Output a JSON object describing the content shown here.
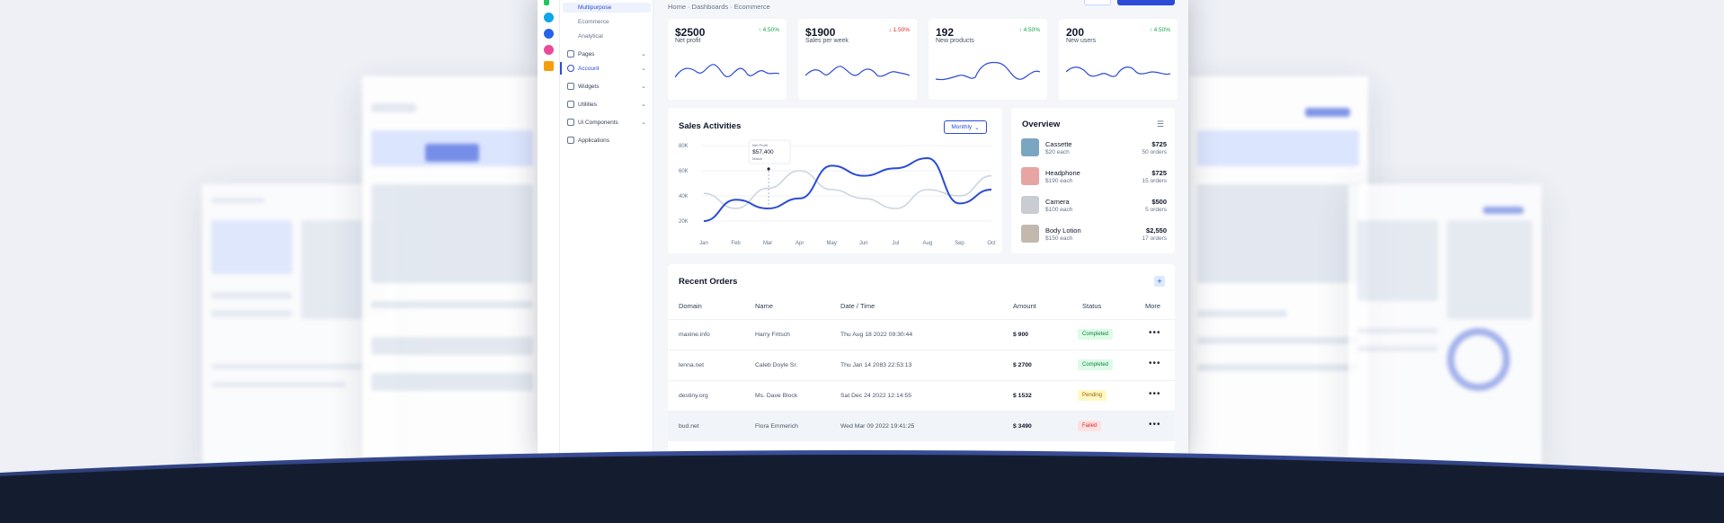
{
  "breadcrumb": "Home · Dashboards · Ecommerce",
  "sidebar": {
    "sub_items": [
      "Multipurpose",
      "Ecommerce",
      "Analytical"
    ],
    "items": [
      {
        "label": "Pages",
        "icon": "pages-icon"
      },
      {
        "label": "Account",
        "icon": "user-icon"
      },
      {
        "label": "Widgets",
        "icon": "bookmark-icon"
      },
      {
        "label": "Utilities",
        "icon": "tools-icon"
      },
      {
        "label": "Ui Components",
        "icon": "components-icon"
      },
      {
        "label": "Applications",
        "icon": "apps-icon"
      }
    ]
  },
  "stats": [
    {
      "value": "$2500",
      "label": "Net profit",
      "change": "4.50%",
      "trend": "up"
    },
    {
      "value": "$1900",
      "label": "Sales per week",
      "change": "1.50%",
      "trend": "down"
    },
    {
      "value": "192",
      "label": "New products",
      "change": "4.50%",
      "trend": "up"
    },
    {
      "value": "200",
      "label": "New users",
      "change": "4.50%",
      "trend": "up"
    }
  ],
  "sales": {
    "title": "Sales Activities",
    "period": "Monthly",
    "tooltip": {
      "label": "Net Profit",
      "value": "$57,400",
      "month": "March"
    }
  },
  "chart_data": {
    "type": "line",
    "title": "Sales Activities",
    "categories": [
      "Jan",
      "Feb",
      "Mar",
      "Apr",
      "May",
      "Jun",
      "Jul",
      "Aug",
      "Sep",
      "Oct"
    ],
    "yticks": [
      "80K",
      "60K",
      "40K",
      "20K"
    ],
    "ylim": [
      10000,
      85000
    ],
    "series": [
      {
        "color": "#2c4bd6",
        "values": [
          20000,
          37000,
          30000,
          38000,
          64000,
          56000,
          62000,
          70000,
          34000,
          45000
        ]
      },
      {
        "color": "#cbd5e1",
        "values": [
          42000,
          30000,
          46000,
          60000,
          45000,
          38000,
          30000,
          45000,
          40000,
          56000
        ]
      }
    ]
  },
  "overview": {
    "title": "Overview",
    "items": [
      {
        "name": "Cassette",
        "each": "$20 each",
        "price": "$725",
        "orders": "50 orders",
        "thumb": "#7aa6c2"
      },
      {
        "name": "Headphone",
        "each": "$190 each",
        "price": "$725",
        "orders": "15 orders",
        "thumb": "#e8a3a3"
      },
      {
        "name": "Camera",
        "each": "$100 each",
        "price": "$500",
        "orders": "5 orders",
        "thumb": "#c9ccd3"
      },
      {
        "name": "Body Lotion",
        "each": "$150 each",
        "price": "$2,550",
        "orders": "17 orders",
        "thumb": "#c2b8ae"
      }
    ]
  },
  "orders": {
    "title": "Recent Orders",
    "columns": [
      "Domain",
      "Name",
      "Date / Time",
      "Amount",
      "Status",
      "More"
    ],
    "rows": [
      {
        "domain": "maxine.info",
        "name": "Harry Fritsch",
        "date": "Thu Aug 18 2022 09:30:44",
        "amount": "$ 900",
        "status": "Completed"
      },
      {
        "domain": "lenna.net",
        "name": "Caleb Doyle Sr.",
        "date": "Thu Jan 14 2083 22:53:13",
        "amount": "$ 2700",
        "status": "Completed"
      },
      {
        "domain": "destiny.org",
        "name": "Ms. Dave Block",
        "date": "Sat Dec 24 2022 12:14:55",
        "amount": "$ 1532",
        "status": "Pending"
      },
      {
        "domain": "bud.net",
        "name": "Flora Emmerich",
        "date": "Wed Mar 09 2022 19:41:25",
        "amount": "$ 3490",
        "status": "Failed"
      }
    ]
  }
}
